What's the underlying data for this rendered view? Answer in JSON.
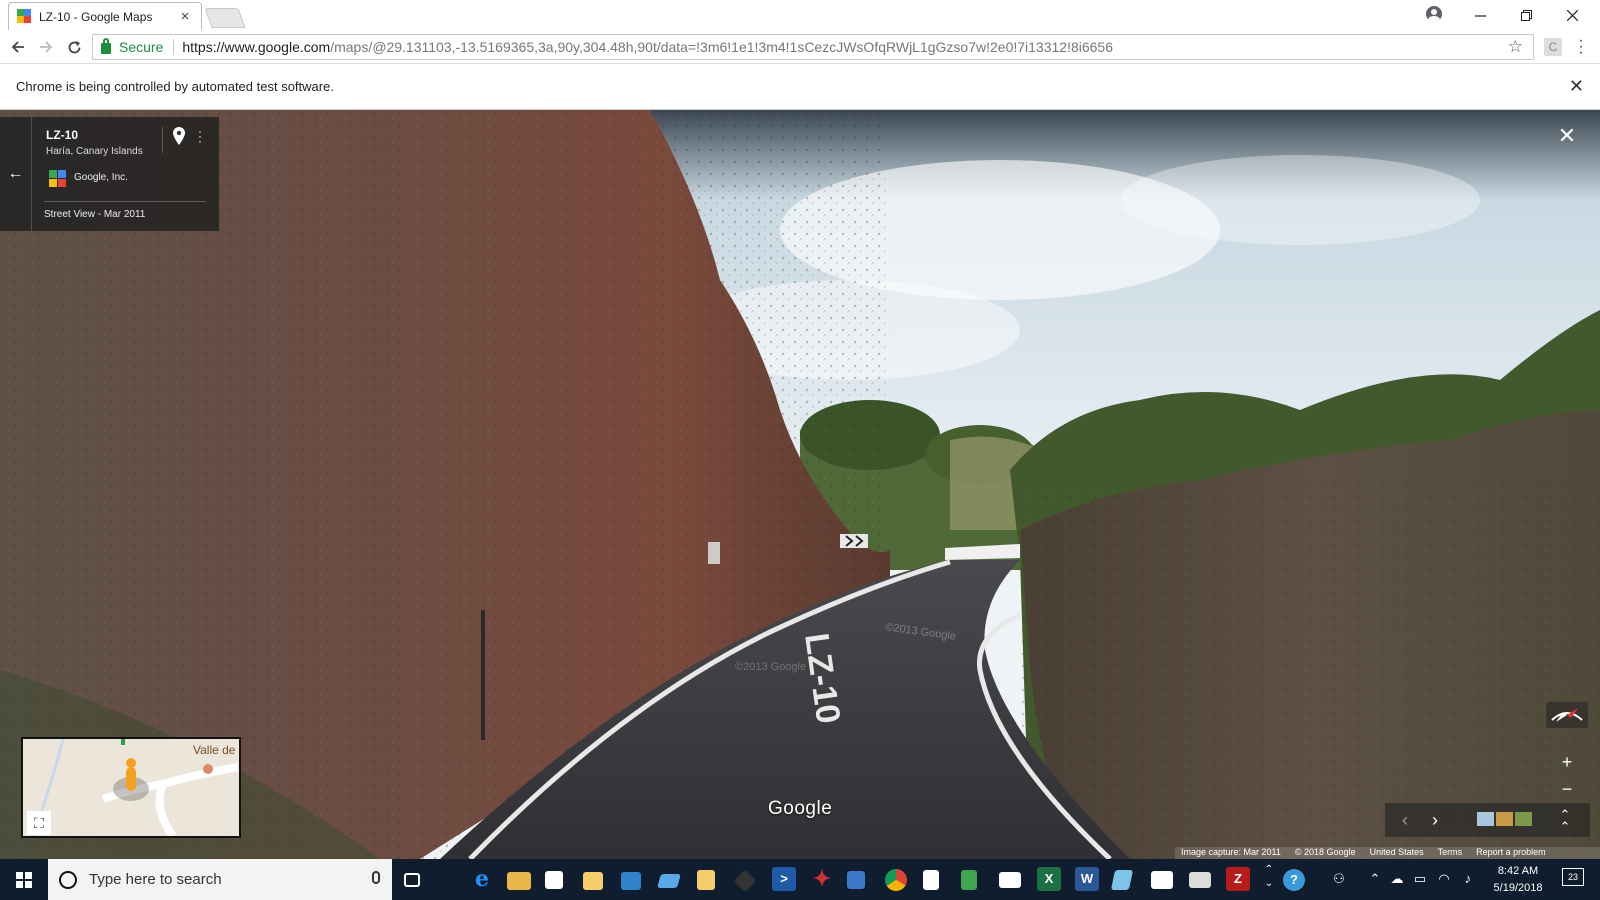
{
  "browser": {
    "tab_title": "LZ-10 - Google Maps",
    "tab_close": "×",
    "secure_label": "Secure",
    "url_host": "https://www.google.com",
    "url_rest": "/maps/@29.131103,-13.5169365,3a,90y,304.48h,90t/data=!3m6!1e1!3m4!1sCezcJWsOfqRWjL1gGzso7w!2e0!7i13312!8i6656",
    "infobar_text": "Chrome is being controlled by automated test software.",
    "icons": [
      "favicon-maps-icon",
      "new-tab-icon",
      "profile-icon",
      "minimize-icon",
      "maximize-icon",
      "close-window-icon",
      "back-icon",
      "forward-icon",
      "reload-icon",
      "lock-icon",
      "star-icon",
      "extension-icon",
      "menu-icon",
      "close-infobar-icon"
    ]
  },
  "streetview": {
    "title": "LZ-10",
    "subtitle": "Haría, Canary Islands",
    "owner": "Google, Inc.",
    "date": "Street View - Mar 2011",
    "road_marking": "LZ-10",
    "watermark_1": "©2013 Google",
    "watermark_2": "©2013 Google",
    "brand": "Google",
    "minimap_label": "Valle de",
    "attribution": {
      "capture": "Image capture: Mar 2011",
      "copyright": "© 2018 Google",
      "country": "United States",
      "terms": "Terms",
      "report": "Report a problem"
    },
    "controls": {
      "zoom_in": "+",
      "zoom_out": "−",
      "close": "✕",
      "back": "←",
      "prev": "‹",
      "next": "›"
    },
    "colors": {
      "panel_bg": "#222222",
      "sky": "#d8e6ee",
      "rock": "#6b4f44",
      "road": "#3a3a3c",
      "foliage": "#3d5a2a"
    }
  },
  "taskbar": {
    "search_placeholder": "Type here to search",
    "time": "8:42 AM",
    "date": "5/19/2018",
    "notification_count": "23",
    "app_letters": {
      "excel": "X",
      "word": "W",
      "filezilla": "Z",
      "powershell": ">",
      "help": "?"
    },
    "pinned_apps": [
      "task-view",
      "edge",
      "file-explorer",
      "store",
      "files",
      "outlook",
      "vpn",
      "folder",
      "terminal",
      "powershell",
      "red-app",
      "network",
      "chrome",
      "word-doc",
      "notepad",
      "mail",
      "excel",
      "word",
      "sticky",
      "photos",
      "remote-desktop",
      "filezilla"
    ]
  }
}
